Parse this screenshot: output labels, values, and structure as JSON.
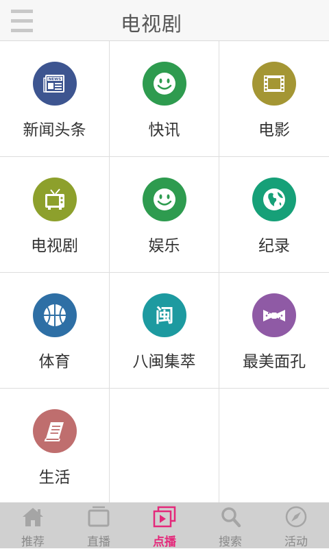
{
  "header": {
    "title": "电视剧",
    "menu_icon": "hamburger-menu-icon"
  },
  "colors": {
    "header_bg": "#f7f7f7",
    "tabbar_bg": "#d0d0d0",
    "active_tab": "#e4287a",
    "inactive_tab": "#8a8a8a"
  },
  "categories": [
    {
      "label": "新闻头条",
      "icon": "newspaper-icon",
      "color": "#3d5590"
    },
    {
      "label": "快讯",
      "icon": "smiley-icon",
      "color": "#2e9b4f"
    },
    {
      "label": "电影",
      "icon": "film-strip-icon",
      "color": "#a49634"
    },
    {
      "label": "电视剧",
      "icon": "tv-icon",
      "color": "#8da02c"
    },
    {
      "label": "娱乐",
      "icon": "smiley-icon",
      "color": "#2e9b4f"
    },
    {
      "label": "纪录",
      "icon": "globe-icon",
      "color": "#16a078"
    },
    {
      "label": "体育",
      "icon": "basketball-icon",
      "color": "#2e6fa5"
    },
    {
      "label": "八闽集萃",
      "icon": "min-character-icon",
      "color": "#1d9aa0",
      "glyph": "闽"
    },
    {
      "label": "最美面孔",
      "icon": "bow-tie-icon",
      "color": "#8f5aa5"
    },
    {
      "label": "生活",
      "icon": "book-icon",
      "color": "#bf6e6e"
    }
  ],
  "tabs": [
    {
      "label": "推荐",
      "icon": "home-icon",
      "active": false
    },
    {
      "label": "直播",
      "icon": "tv-live-icon",
      "active": false
    },
    {
      "label": "点播",
      "icon": "play-vod-icon",
      "active": true
    },
    {
      "label": "搜索",
      "icon": "search-icon",
      "active": false
    },
    {
      "label": "活动",
      "icon": "compass-icon",
      "active": false
    }
  ]
}
